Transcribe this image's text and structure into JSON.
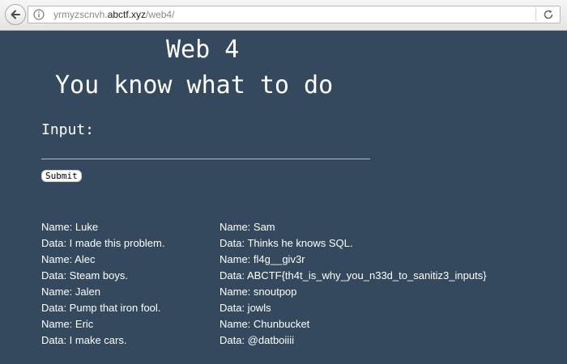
{
  "browser": {
    "url_prefix": "yrmyzscnvh.",
    "url_domain": "abctf.xyz",
    "url_path": "/web4/",
    "back_icon": "back-arrow-icon",
    "info_icon": "info-icon",
    "reload_icon": "reload-icon"
  },
  "page": {
    "title": "Web 4",
    "subtitle": "You know what to do",
    "input_label": "Input:",
    "input_value": "",
    "submit_label": "Submit",
    "background_color": "#34495e"
  },
  "results": {
    "left": [
      "Name: Luke",
      "Data: I made this problem.",
      "Name: Alec",
      "Data: Steam boys.",
      "Name: Jalen",
      "Data: Pump that iron fool.",
      "Name: Eric",
      "Data: I make cars."
    ],
    "right": [
      "Name: Sam",
      "Data: Thinks he knows SQL.",
      "Name: fl4g__giv3r",
      "Data: ABCTF{th4t_is_why_you_n33d_to_sanitiz3_inputs}",
      "Name: snoutpop",
      "Data: jowls",
      "Name: Chunbucket",
      "Data: @datboiiii"
    ]
  }
}
